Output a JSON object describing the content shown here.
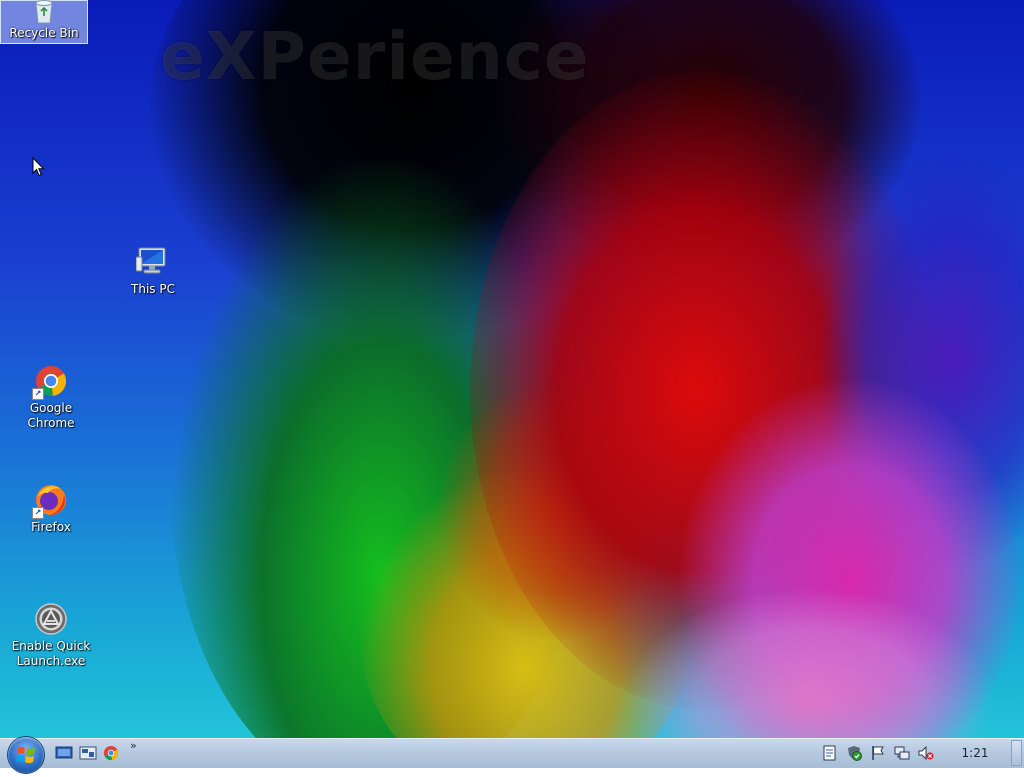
{
  "watermark_text": "eXPerience",
  "desktop": {
    "icons": [
      {
        "label": "Recycle Bin",
        "icon": "recycle-bin-icon",
        "selected": true
      },
      {
        "label": "This PC",
        "icon": "computer-icon",
        "selected": false
      },
      {
        "label": "Google Chrome",
        "icon": "chrome-icon",
        "shortcut": true
      },
      {
        "label": "Firefox",
        "icon": "firefox-icon",
        "shortcut": true
      },
      {
        "label": "Enable Quick Launch.exe",
        "icon": "quick-launch-icon"
      }
    ]
  },
  "taskbar": {
    "quick_launch": [
      "show-desktop-icon",
      "window-switcher-icon",
      "chrome-icon"
    ],
    "overflow_glyph": "»",
    "tray_icons": [
      "notes-icon",
      "security-shield-icon",
      "action-center-flag-icon",
      "network-icon",
      "volume-muted-icon"
    ],
    "clock": "1:21"
  },
  "colors": {
    "taskbar_top": "#c9d9ec",
    "taskbar_bottom": "#a8bdd6",
    "selection": "#c8dcff",
    "wallpaper_blue": "#1a3fd0",
    "wallpaper_red": "#dc0a0a",
    "wallpaper_green": "#14be1e"
  }
}
